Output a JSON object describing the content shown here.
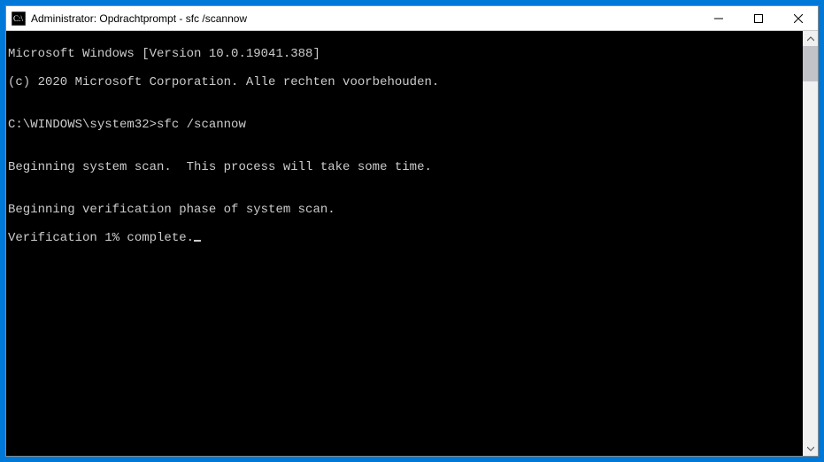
{
  "titlebar": {
    "title": "Administrator: Opdrachtprompt - sfc  /scannow"
  },
  "terminal": {
    "line1": "Microsoft Windows [Version 10.0.19041.388]",
    "line2": "(c) 2020 Microsoft Corporation. Alle rechten voorbehouden.",
    "blank1": "",
    "prompt": "C:\\WINDOWS\\system32>",
    "command": "sfc /scannow",
    "blank2": "",
    "line3": "Beginning system scan.  This process will take some time.",
    "blank3": "",
    "line4": "Beginning verification phase of system scan.",
    "line5": "Verification 1% complete."
  }
}
